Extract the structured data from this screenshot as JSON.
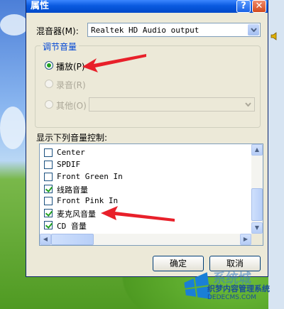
{
  "window": {
    "title": "属性",
    "help_glyph": "?",
    "close_glyph": "✕"
  },
  "mixer": {
    "label": "混音器(M):",
    "value": "Realtek HD Audio output"
  },
  "volume_group": {
    "title": "调节音量",
    "options": [
      {
        "label": "播放(P)",
        "checked": true,
        "enabled": true
      },
      {
        "label": "录音(R)",
        "checked": false,
        "enabled": false
      },
      {
        "label": "其他(O)",
        "checked": false,
        "enabled": false
      }
    ]
  },
  "controls": {
    "label": "显示下列音量控制:",
    "items": [
      {
        "label": "Center",
        "checked": false
      },
      {
        "label": "SPDIF",
        "checked": false
      },
      {
        "label": "Front Green In",
        "checked": false
      },
      {
        "label": "线路音量",
        "checked": true
      },
      {
        "label": "Front Pink In",
        "checked": false
      },
      {
        "label": "麦克风音量",
        "checked": true
      },
      {
        "label": "CD 音量",
        "checked": true
      }
    ]
  },
  "buttons": {
    "ok": "确定",
    "cancel": "取消"
  },
  "watermark": {
    "logo": "系统城",
    "line1": "织梦内容管理系统",
    "line2": "DEDECMS.COM"
  },
  "colors": {
    "titlebar": "#0a5ae0",
    "accent_green": "#21a121",
    "arrow": "#e8202a",
    "group_title": "#0046d5"
  }
}
